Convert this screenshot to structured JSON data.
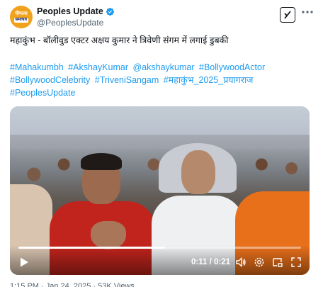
{
  "account": {
    "name": "Peoples Update",
    "handle": "@PeoplesUpdate",
    "avatar_text_top": "पीपल्स",
    "avatar_text_bottom": "समाचार",
    "verified": true,
    "verified_color": "#1d9bf0"
  },
  "post": {
    "headline": "महाकुंभ - बॉलीवुड एक्टर अक्षय कुमार ने त्रिवेणी संगम में लगाई डुबकी",
    "hashtags": [
      "#Mahakumbh",
      "#AkshayKumar",
      "@akshaykumar",
      "#BollywoodActor",
      "#BollywoodCelebrity",
      "#TriveniSangam",
      "#महाकुंभ_2025_प्रयागराज",
      "#PeoplesUpdate"
    ],
    "link_color": "#1d9bf0"
  },
  "video": {
    "current_time": "0:11",
    "duration": "0:21",
    "time_separator": "/",
    "progress": 0.52
  },
  "icons": {
    "grok": "grok-icon",
    "more": "more-icon",
    "play": "play-icon",
    "volume": "volume-icon",
    "settings": "settings-icon",
    "pip": "pip-icon",
    "fullscreen": "fullscreen-icon"
  },
  "footer": {
    "timestamp_partial": "1:15 PM · Jan 24, 2025 · 53K Views"
  }
}
